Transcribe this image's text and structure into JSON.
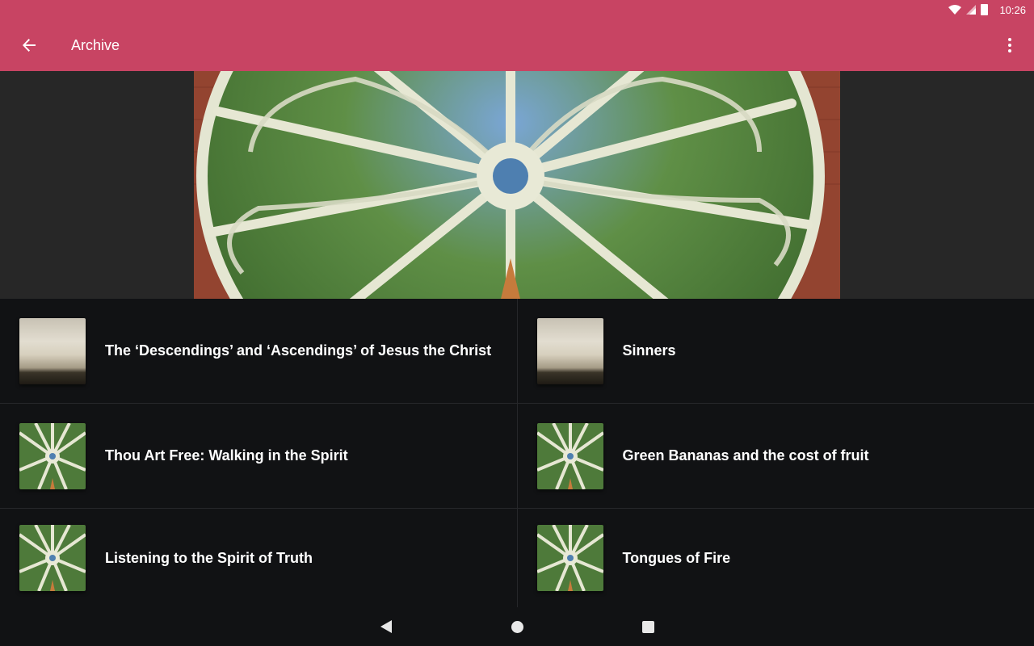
{
  "status_bar": {
    "time": "10:26",
    "icons": [
      "wifi-icon",
      "signal-icon",
      "battery-icon"
    ]
  },
  "app_bar": {
    "title": "Archive",
    "back_icon": "arrow-back-icon",
    "menu_icon": "overflow-menu-icon",
    "color": "#c84463"
  },
  "header": {
    "image": "rose-window-image"
  },
  "list": {
    "items": [
      {
        "title": "The ‘Descendings’ and ‘Ascendings’ of Jesus the Christ",
        "thumb": "sky-thumbnail"
      },
      {
        "title": "Sinners",
        "thumb": "sky-thumbnail"
      },
      {
        "title": "Thou Art Free: Walking in the Spirit",
        "thumb": "rose-window-thumbnail"
      },
      {
        "title": "Green Bananas and the cost of fruit",
        "thumb": "rose-window-thumbnail"
      },
      {
        "title": "Listening to the Spirit of Truth",
        "thumb": "rose-window-thumbnail"
      },
      {
        "title": "Tongues of Fire",
        "thumb": "rose-window-thumbnail"
      }
    ]
  },
  "nav_bar": {
    "buttons": [
      "nav-back-icon",
      "nav-home-icon",
      "nav-recents-icon"
    ]
  }
}
